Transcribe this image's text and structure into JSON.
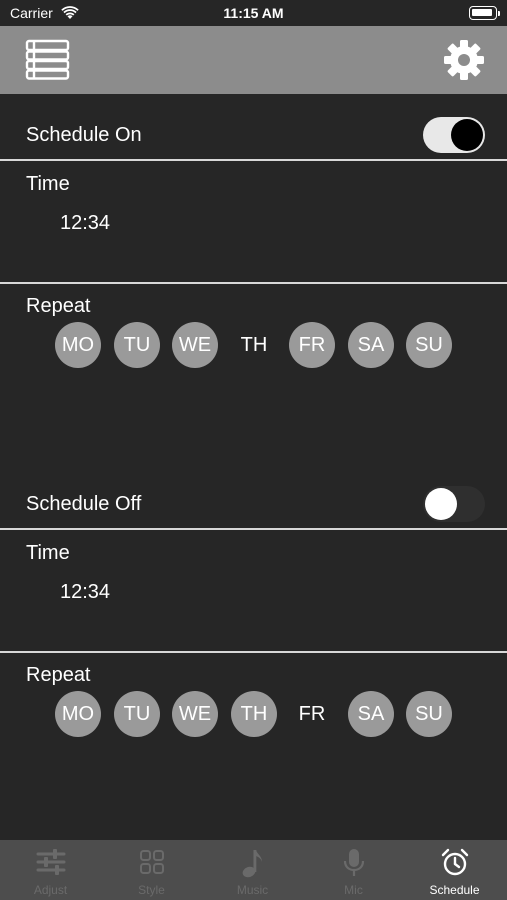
{
  "status": {
    "carrier": "Carrier",
    "time": "11:15 AM"
  },
  "nav": {
    "menu_icon": "list-menu-icon",
    "settings_icon": "gear-icon"
  },
  "schedules": [
    {
      "title": "Schedule On",
      "enabled": true,
      "time_label": "Time",
      "time": "12:34",
      "repeat_label": "Repeat",
      "days": [
        {
          "label": "MO",
          "selected": true
        },
        {
          "label": "TU",
          "selected": true
        },
        {
          "label": "WE",
          "selected": true
        },
        {
          "label": "TH",
          "selected": false
        },
        {
          "label": "FR",
          "selected": true
        },
        {
          "label": "SA",
          "selected": true
        },
        {
          "label": "SU",
          "selected": true
        }
      ]
    },
    {
      "title": "Schedule Off",
      "enabled": false,
      "time_label": "Time",
      "time": "12:34",
      "repeat_label": "Repeat",
      "days": [
        {
          "label": "MO",
          "selected": true
        },
        {
          "label": "TU",
          "selected": true
        },
        {
          "label": "WE",
          "selected": true
        },
        {
          "label": "TH",
          "selected": true
        },
        {
          "label": "FR",
          "selected": false
        },
        {
          "label": "SA",
          "selected": true
        },
        {
          "label": "SU",
          "selected": true
        }
      ]
    }
  ],
  "tabs": [
    {
      "label": "Adjust",
      "icon": "sliders-icon",
      "active": false
    },
    {
      "label": "Style",
      "icon": "grid-icon",
      "active": false
    },
    {
      "label": "Music",
      "icon": "music-note-icon",
      "active": false
    },
    {
      "label": "Mic",
      "icon": "microphone-icon",
      "active": false
    },
    {
      "label": "Schedule",
      "icon": "alarm-clock-icon",
      "active": true
    }
  ],
  "colors": {
    "background": "#262626",
    "nav_bar": "#8c8c8c",
    "tab_bar": "#4d4d4d",
    "day_selected": "#9a9a9a",
    "divider": "#d8d8d8"
  }
}
